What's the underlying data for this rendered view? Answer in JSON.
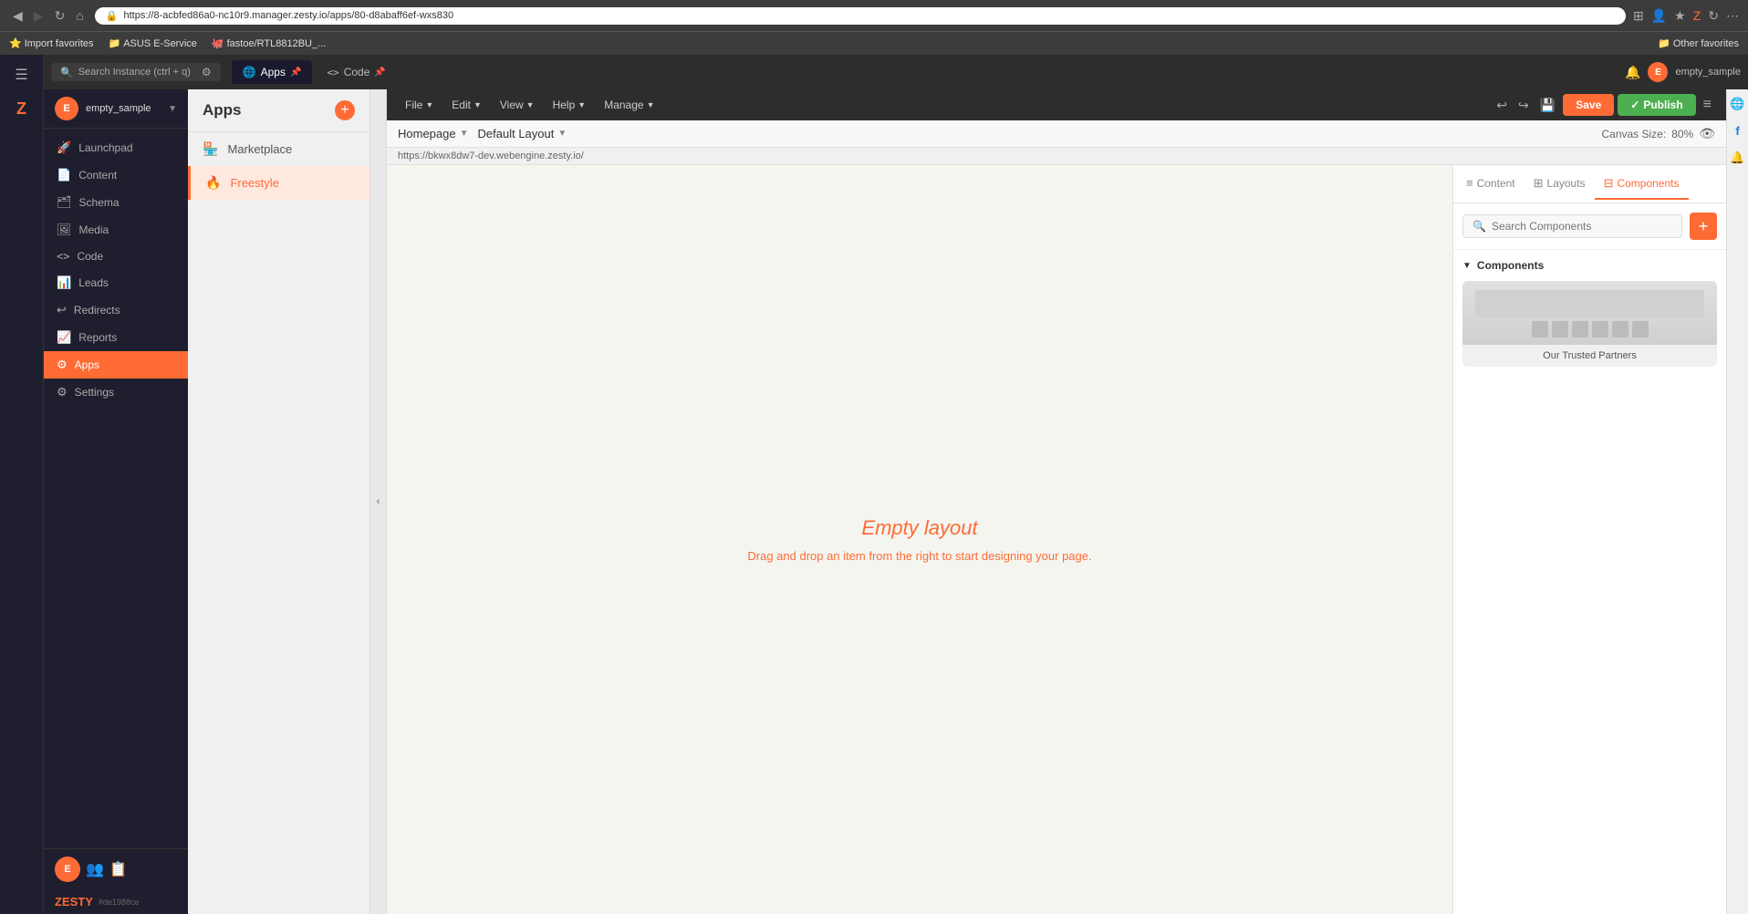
{
  "browser": {
    "url": "https://8-acbfed86a0-nc10r9.manager.zesty.io/apps/80-d8abaff6ef-wxs830",
    "back_icon": "◀",
    "forward_icon": "▶",
    "refresh_icon": "↻",
    "home_icon": "⌂"
  },
  "bookmarks": [
    {
      "label": "Import favorites",
      "icon": "⭐"
    },
    {
      "label": "ASUS E-Service",
      "icon": "📁"
    },
    {
      "label": "fastoe/RTL8812BU_...",
      "icon": "🐙"
    },
    {
      "label": "Other favorites",
      "icon": "📁"
    }
  ],
  "tabs": [
    {
      "label": "Apps",
      "icon": "🌐",
      "active": true,
      "pinned": false
    },
    {
      "label": "Code",
      "icon": "<>",
      "active": false,
      "pinned": true
    }
  ],
  "search_instance": {
    "placeholder": "Search Instance (ctrl + q)"
  },
  "left_nav": {
    "user": {
      "initials": "E",
      "name": "empty_sample",
      "dropdown": true
    },
    "items": [
      {
        "id": "launchpad",
        "label": "Launchpad",
        "icon": "🚀"
      },
      {
        "id": "content",
        "label": "Content",
        "icon": "📄"
      },
      {
        "id": "schema",
        "label": "Schema",
        "icon": "🗂"
      },
      {
        "id": "media",
        "label": "Media",
        "icon": "🖼"
      },
      {
        "id": "code",
        "label": "Code",
        "icon": "<>"
      },
      {
        "id": "leads",
        "label": "Leads",
        "icon": "📊"
      },
      {
        "id": "redirects",
        "label": "Redirects",
        "icon": "↩"
      },
      {
        "id": "reports",
        "label": "Reports",
        "icon": "📈"
      },
      {
        "id": "apps",
        "label": "Apps",
        "icon": "⚙",
        "active": true
      },
      {
        "id": "settings",
        "label": "Settings",
        "icon": "⚙"
      }
    ],
    "logo": "ZESTY",
    "version": "#de1988ce"
  },
  "apps_subnav": {
    "title": "Apps",
    "items": [
      {
        "id": "marketplace",
        "label": "Marketplace",
        "icon": "🏪",
        "active": false
      },
      {
        "id": "freestyle",
        "label": "Freestyle",
        "icon": "🔥",
        "active": true
      }
    ]
  },
  "toolbar": {
    "file_label": "File",
    "edit_label": "Edit",
    "view_label": "View",
    "help_label": "Help",
    "manage_label": "Manage",
    "save_label": "Save",
    "publish_label": "Publish"
  },
  "editor_header": {
    "page_label": "Homepage",
    "layout_label": "Default Layout",
    "canvas_size_label": "Canvas Size:",
    "canvas_size_value": "80%"
  },
  "url_bar": {
    "url": "https://bkwx8dw7-dev.webengine.zesty.io/"
  },
  "canvas": {
    "empty_title": "Empty layout",
    "empty_desc": "Drag and drop an item from the right to start designing your page."
  },
  "right_panel": {
    "tabs": [
      {
        "id": "content",
        "label": "Content",
        "icon": "≡",
        "active": false
      },
      {
        "id": "layouts",
        "label": "Layouts",
        "icon": "⊞",
        "active": false
      },
      {
        "id": "components",
        "label": "Components",
        "icon": "⊟",
        "active": true
      }
    ],
    "search_placeholder": "Search Components",
    "components_section_label": "Components",
    "component_cards": [
      {
        "name": "Our Trusted Partners"
      }
    ]
  },
  "far_right": {
    "icons": [
      "🌐",
      "f",
      "🔔"
    ]
  }
}
